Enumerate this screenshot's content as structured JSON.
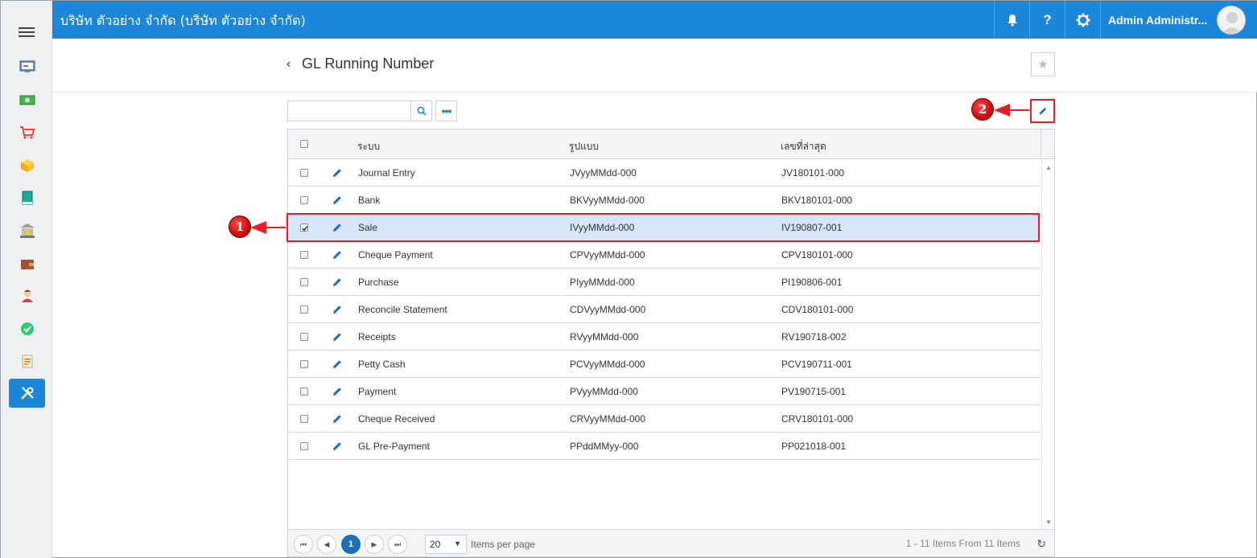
{
  "topbar": {
    "company": "บริษัท ตัวอย่าง จำกัด (บริษัท ตัวอย่าง จำกัด)",
    "help_label": "?",
    "user_name": "Admin Administr..."
  },
  "sidebar": {
    "items": [
      {
        "icon": "dashboard-icon"
      },
      {
        "icon": "money-icon"
      },
      {
        "icon": "cart-icon"
      },
      {
        "icon": "box-icon"
      },
      {
        "icon": "book-icon"
      },
      {
        "icon": "bank-icon"
      },
      {
        "icon": "wallet-icon"
      },
      {
        "icon": "person-icon"
      },
      {
        "icon": "check-icon"
      },
      {
        "icon": "report-icon"
      },
      {
        "icon": "tools-icon",
        "active": true
      }
    ]
  },
  "page": {
    "back": "‹",
    "title": "GL Running Number",
    "favorite": "★"
  },
  "toolbar": {
    "search_value": "",
    "search_placeholder": "",
    "more_label": "•••"
  },
  "grid": {
    "columns": {
      "system": "ระบบ",
      "format": "รูปแบบ",
      "latest": "เลขที่ล่าสุด"
    },
    "rows": [
      {
        "system": "Journal Entry",
        "format": "JVyyMMdd-000",
        "latest": "JV180101-000",
        "checked": false
      },
      {
        "system": "Bank",
        "format": "BKVyyMMdd-000",
        "latest": "BKV180101-000",
        "checked": false
      },
      {
        "system": "Sale",
        "format": "IVyyMMdd-000",
        "latest": "IV190807-001",
        "checked": true
      },
      {
        "system": "Cheque Payment",
        "format": "CPVyyMMdd-000",
        "latest": "CPV180101-000",
        "checked": false
      },
      {
        "system": "Purchase",
        "format": "PIyyMMdd-000",
        "latest": "PI190806-001",
        "checked": false
      },
      {
        "system": "Reconcile Statement",
        "format": "CDVyyMMdd-000",
        "latest": "CDV180101-000",
        "checked": false
      },
      {
        "system": "Receipts",
        "format": "RVyyMMdd-000",
        "latest": "RV190718-002",
        "checked": false
      },
      {
        "system": "Petty Cash",
        "format": "PCVyyMMdd-000",
        "latest": "PCV190711-001",
        "checked": false
      },
      {
        "system": "Payment",
        "format": "PVyyMMdd-000",
        "latest": "PV190715-001",
        "checked": false
      },
      {
        "system": "Cheque Received",
        "format": "CRVyyMMdd-000",
        "latest": "CRV180101-000",
        "checked": false
      },
      {
        "system": "GL Pre-Payment",
        "format": "PPddMMyy-000",
        "latest": "PP021018-001",
        "checked": false
      }
    ]
  },
  "pager": {
    "current_page": "1",
    "page_size": "20",
    "items_per_page": "Items per page",
    "info": "1 - 11 Items From 11 Items"
  },
  "callouts": {
    "one": "1",
    "two": "2"
  },
  "colors": {
    "accent": "#1c87d8",
    "selected_row": "#d6e6f7",
    "callout": "#e0202a"
  }
}
